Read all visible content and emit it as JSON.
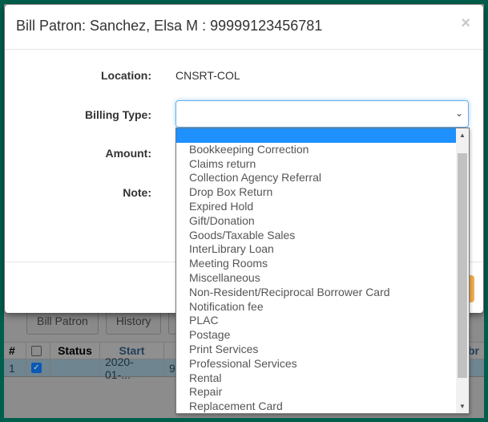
{
  "modal": {
    "title": "Bill Patron: Sanchez, Elsa M : 99999123456781",
    "close": "×",
    "location_label": "Location:",
    "location_value": "CNSRT-COL",
    "billing_label": "Billing Type:",
    "billing_value": "",
    "amount_label": "Amount:",
    "note_label": "Note:"
  },
  "dropdown": {
    "scroll_fraction": 0.0,
    "options": [
      "",
      "Bookkeeping Correction",
      "Claims return",
      "Collection Agency Referral",
      "Drop Box Return",
      "Expired Hold",
      "Gift/Donation",
      "Goods/Taxable Sales",
      "InterLibrary Loan",
      "Meeting Rooms",
      "Miscellaneous",
      "Non-Resident/Reciprocal Borrower Card",
      "Notification fee",
      "PLAC",
      "Postage",
      "Print Services",
      "Professional Services",
      "Rental",
      "Repair",
      "Replacement Card"
    ]
  },
  "background": {
    "buttons": [
      "Bill Patron",
      "History"
    ],
    "table": {
      "headers": [
        "#",
        "",
        "Status",
        "Start",
        "",
        "Libr"
      ],
      "row": [
        "1",
        "",
        "",
        "2020-01-...",
        "9"
      ]
    }
  },
  "colors": {
    "frame": "#005e4c",
    "highlight": "#1e90ff",
    "warning": "#f0ad4e"
  }
}
